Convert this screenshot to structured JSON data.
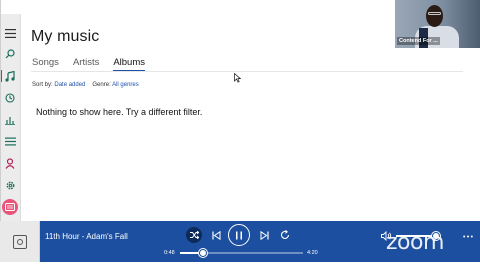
{
  "app": {
    "page_title": "My music",
    "tabs": [
      {
        "label": "Songs",
        "selected": false
      },
      {
        "label": "Artists",
        "selected": false
      },
      {
        "label": "Albums",
        "selected": true
      }
    ],
    "filters": {
      "sort_label": "Sort by:",
      "sort_value": "Date added",
      "genre_label": "Genre:",
      "genre_value": "All genres"
    },
    "empty_message": "Nothing to show here. Try a different filter."
  },
  "nav_rail": {
    "icons": [
      "hamburger-icon",
      "search-icon",
      "music-note-icon",
      "clock-icon",
      "equalizer-icon",
      "list-icon",
      "person-icon",
      "gear-icon",
      "avatar-icon"
    ],
    "active": "music-note-icon"
  },
  "webcam": {
    "participant_name": "Contend For ..."
  },
  "player": {
    "now_playing": "11th Hour - Adam's Fall",
    "elapsed": "0:48",
    "total": "4:20",
    "progress_fraction": 0.19,
    "volume_fraction": 0.9,
    "accent_color": "#1d4fa0"
  },
  "overlay": {
    "brand": "zoom"
  }
}
